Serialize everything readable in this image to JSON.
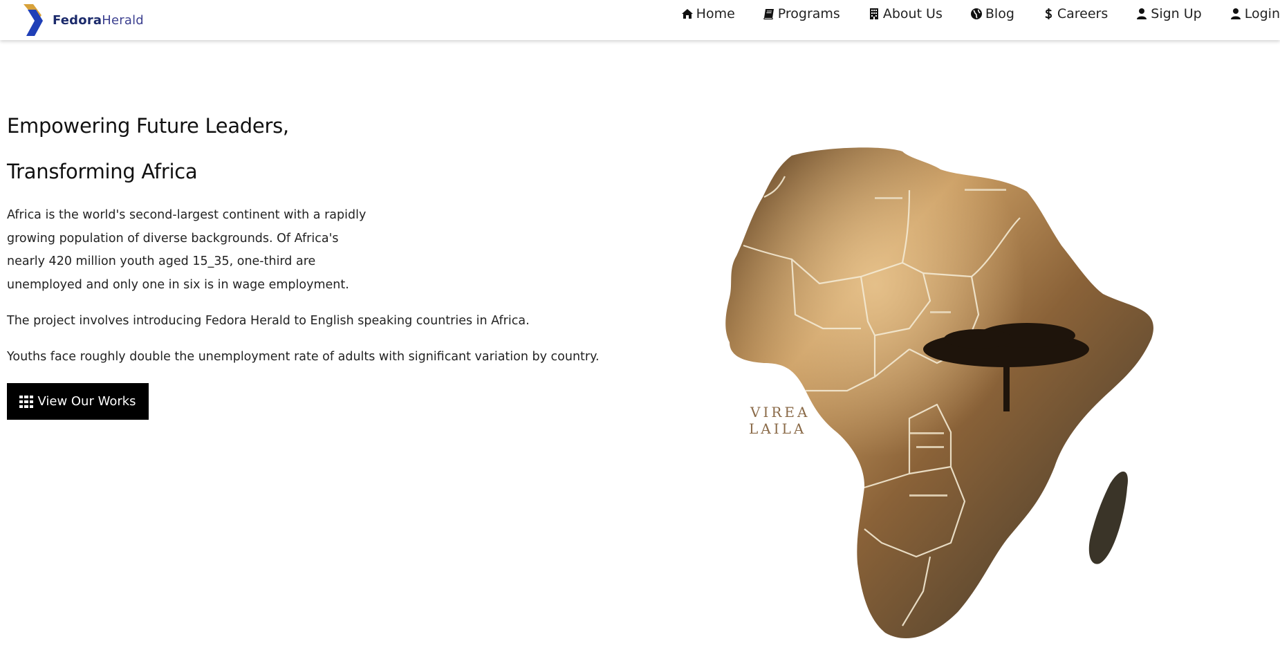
{
  "brand": {
    "name_bold": "Fedora",
    "name_light": "Herald",
    "colors": {
      "gold": "#d8a23a",
      "blue": "#1f3fb7"
    }
  },
  "nav": {
    "items": [
      {
        "label": "Home",
        "icon": "home-icon"
      },
      {
        "label": "Programs",
        "icon": "book-icon"
      },
      {
        "label": "About Us",
        "icon": "building-icon"
      },
      {
        "label": "Blog",
        "icon": "globe-icon"
      },
      {
        "label": "Careers",
        "icon": "dollar-icon"
      },
      {
        "label": "Sign Up",
        "icon": "user-icon"
      },
      {
        "label": "Login",
        "icon": "user-icon"
      }
    ]
  },
  "hero": {
    "title_line1": "Empowering Future Leaders,",
    "title_line2": "Transforming Africa",
    "paragraph1": "Africa is the world's second-largest continent with a rapidly growing population of diverse backgrounds. Of Africa's nearly 420 million youth aged 15_35, one-third are unemployed and only one in six is in wage employment.",
    "paragraph2": "The project involves introducing Fedora Herald to English speaking countries in Africa.",
    "paragraph3": "Youths face roughly double the unemployment rate of adults with significant variation by country.",
    "cta_label": "View Our Works",
    "cta_icon": "grid-icon"
  },
  "map": {
    "label_line1": "VIREA",
    "label_line2": "LAILA"
  }
}
